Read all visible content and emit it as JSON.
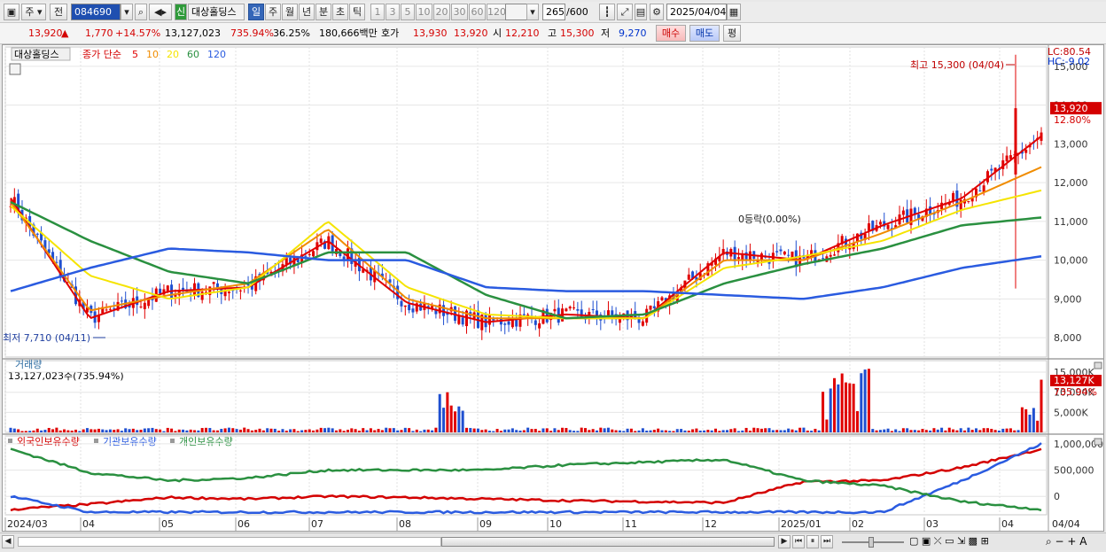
{
  "toolbar": {
    "market_btn": "주",
    "prev_btn": "전",
    "code": "084690",
    "shin_badge": "신",
    "stock_name": "대상홀딩스",
    "period_tabs": [
      "일",
      "주",
      "월",
      "년",
      "분",
      "초",
      "틱"
    ],
    "active_period": "일",
    "interval_btns": [
      "1",
      "3",
      "5",
      "10",
      "20",
      "30",
      "60",
      "120"
    ],
    "count": "265",
    "count_total": "/600",
    "date": "2025/04/04"
  },
  "quote": {
    "price": "13,920",
    "arrow": "▲",
    "change": "1,770",
    "change_pct": "+14.57%",
    "volume": "13,127,023",
    "volume_ratio": "735.94%",
    "turnover": "36.25%",
    "amount": "180,666백만",
    "hoga_label": "호가",
    "ask": "13,930",
    "bid": "13,920",
    "open_label": "시",
    "open": "12,210",
    "high_label": "고",
    "high": "15,300",
    "low_label": "저",
    "low": "9,270",
    "buy_btn": "매수",
    "sell_btn": "매도",
    "eval_btn": "평"
  },
  "price_pane": {
    "legend_name": "대상홀딩스",
    "legend_ma_title": "종가 단순",
    "ma_periods": [
      "5",
      "10",
      "20",
      "60",
      "120"
    ],
    "ma_colors": [
      "#e00000",
      "#f08c00",
      "#f5e400",
      "#2a9040",
      "#2a5be0"
    ],
    "lc": "LC:80.54",
    "hc": "HC:-9.02",
    "high_note": "최고 15,300 (04/04)",
    "low_note": "최저 7,710 (04/11)",
    "mid_note": "0등락(0.00%)",
    "price_tag": "13,920",
    "pct_tag": "12.80%",
    "y_labels": [
      "15,000",
      "14,000",
      "13,000",
      "12,000",
      "11,000",
      "10,000",
      "9,000",
      "8,000"
    ]
  },
  "volume_pane": {
    "title": "거래량",
    "value_text": "13,127,023주(735.94%)",
    "y_labels": [
      "15,000K",
      "10,000K",
      "5,000K"
    ],
    "tag": "13,127K",
    "tag2": "735.94%"
  },
  "holding_pane": {
    "legend": [
      "외국인보유수량",
      "기관보유수량",
      "개인보유수량"
    ],
    "legend_colors": [
      "#d40000",
      "#2a5be0",
      "#2a9040"
    ],
    "y_labels": [
      "1,000,000",
      "500,000",
      "0"
    ]
  },
  "x_axis": {
    "labels": [
      "2024/03",
      "04",
      "05",
      "06",
      "07",
      "08",
      "09",
      "10",
      "11",
      "12",
      "2025/01",
      "02",
      "03",
      "04"
    ],
    "right_label": "04/04"
  },
  "chart_data": [
    {
      "type": "line",
      "title": "",
      "series_note": "daily candlestick price with simple moving averages",
      "x": [
        "2024/03",
        "2024/04",
        "2024/05",
        "2024/06",
        "2024/07",
        "2024/08",
        "2024/09",
        "2024/10",
        "2024/11",
        "2024/12",
        "2025/01",
        "2025/02",
        "2025/03",
        "2025/04"
      ],
      "series": [
        {
          "name": "5",
          "values": [
            11600,
            8500,
            9200,
            9300,
            10500,
            8900,
            8400,
            8600,
            8500,
            10200,
            10000,
            10900,
            11600,
            13200
          ]
        },
        {
          "name": "10",
          "values": [
            11500,
            8700,
            9100,
            9400,
            10800,
            9000,
            8500,
            8500,
            8500,
            10000,
            10000,
            10700,
            11500,
            12400
          ]
        },
        {
          "name": "20",
          "values": [
            11400,
            9600,
            9000,
            9300,
            11000,
            9300,
            8600,
            8500,
            8500,
            9800,
            10100,
            10500,
            11300,
            11800
          ]
        },
        {
          "name": "60",
          "values": [
            11500,
            10500,
            9700,
            9400,
            10200,
            10200,
            9100,
            8500,
            8600,
            9400,
            9900,
            10300,
            10900,
            11100
          ]
        },
        {
          "name": "120",
          "values": [
            9200,
            9800,
            10300,
            10200,
            10000,
            10000,
            9300,
            9200,
            9200,
            9100,
            9000,
            9300,
            9800,
            10100
          ]
        }
      ],
      "ylim": [
        7500,
        15500
      ],
      "annotations": [
        "최고 15,300 (04/04)",
        "최저 7,710 (04/11)"
      ]
    },
    {
      "type": "bar",
      "title": "거래량",
      "x": [
        "2024/06",
        "2024/12",
        "2025/04"
      ],
      "values": [
        1400,
        16000,
        13127
      ],
      "unit": "K",
      "ylim": [
        0,
        17000
      ]
    },
    {
      "type": "line",
      "title": "",
      "x": [
        "2024/03",
        "2024/04",
        "2024/05",
        "2024/06",
        "2024/07",
        "2024/08",
        "2024/09",
        "2024/10",
        "2024/11",
        "2024/12",
        "2025/01",
        "2025/02",
        "2025/03",
        "2025/04"
      ],
      "series": [
        {
          "name": "외국인보유수량",
          "values": [
            -250000,
            -150000,
            -20000,
            -50000,
            0,
            -20000,
            -50000,
            -80000,
            -100000,
            -120000,
            280000,
            300000,
            550000,
            900000
          ]
        },
        {
          "name": "기관보유수량",
          "values": [
            0,
            -300000,
            -300000,
            -300000,
            -300000,
            -300000,
            -300000,
            -300000,
            -300000,
            -300000,
            -300000,
            -300000,
            300000,
            1000000
          ]
        },
        {
          "name": "개인보유수량",
          "values": [
            900000,
            450000,
            300000,
            350000,
            500000,
            500000,
            500000,
            600000,
            650000,
            700000,
            300000,
            200000,
            -100000,
            -250000
          ]
        }
      ],
      "ylim": [
        -300000,
        1100000
      ]
    }
  ]
}
